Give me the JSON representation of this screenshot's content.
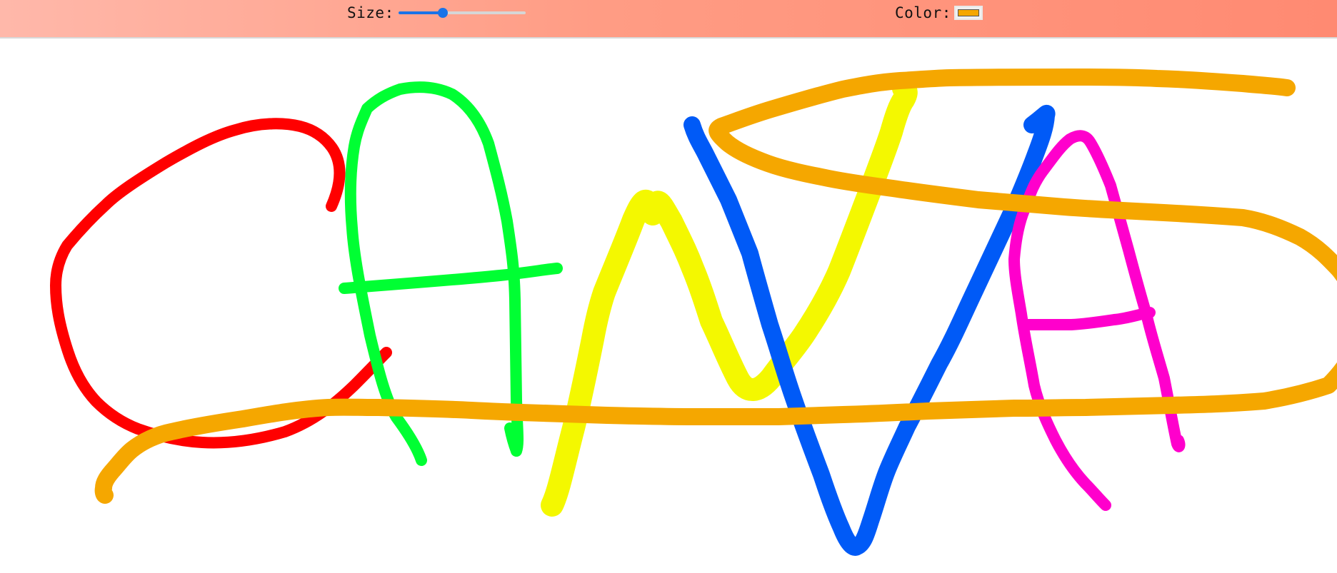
{
  "toolbar": {
    "size_label": "Size:",
    "size_value": 0.35,
    "color_label": "Color:",
    "color_value": "#f5a700"
  },
  "colors": {
    "red": "#ff0000",
    "green": "#00ff33",
    "yellow": "#f4f800",
    "blue": "#005af7",
    "magenta": "#ff00cc",
    "orange": "#f5a700",
    "slider_accent": "#1a73e8"
  }
}
